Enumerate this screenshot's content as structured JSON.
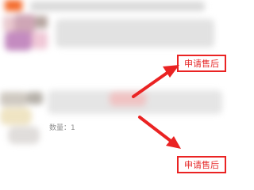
{
  "orders": [
    {
      "after_sale_label": "申请售后"
    },
    {
      "quantity_text": "数量：1",
      "after_sale_label": "申请售后"
    }
  ],
  "colors": {
    "accent_red": "#e52a2a",
    "quantity_gray": "#8e8e8e"
  }
}
